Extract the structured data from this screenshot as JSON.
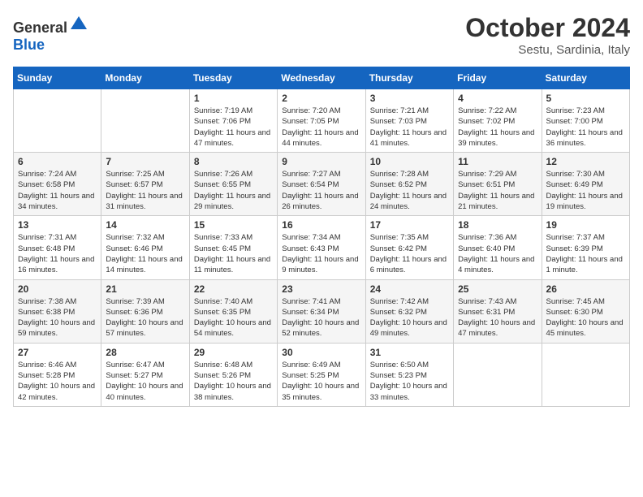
{
  "header": {
    "logo": {
      "text_general": "General",
      "text_blue": "Blue"
    },
    "title": "October 2024",
    "subtitle": "Sestu, Sardinia, Italy"
  },
  "calendar": {
    "days_of_week": [
      "Sunday",
      "Monday",
      "Tuesday",
      "Wednesday",
      "Thursday",
      "Friday",
      "Saturday"
    ],
    "weeks": [
      [
        {
          "day": "",
          "info": ""
        },
        {
          "day": "",
          "info": ""
        },
        {
          "day": "1",
          "info": "Sunrise: 7:19 AM\nSunset: 7:06 PM\nDaylight: 11 hours and 47 minutes."
        },
        {
          "day": "2",
          "info": "Sunrise: 7:20 AM\nSunset: 7:05 PM\nDaylight: 11 hours and 44 minutes."
        },
        {
          "day": "3",
          "info": "Sunrise: 7:21 AM\nSunset: 7:03 PM\nDaylight: 11 hours and 41 minutes."
        },
        {
          "day": "4",
          "info": "Sunrise: 7:22 AM\nSunset: 7:02 PM\nDaylight: 11 hours and 39 minutes."
        },
        {
          "day": "5",
          "info": "Sunrise: 7:23 AM\nSunset: 7:00 PM\nDaylight: 11 hours and 36 minutes."
        }
      ],
      [
        {
          "day": "6",
          "info": "Sunrise: 7:24 AM\nSunset: 6:58 PM\nDaylight: 11 hours and 34 minutes."
        },
        {
          "day": "7",
          "info": "Sunrise: 7:25 AM\nSunset: 6:57 PM\nDaylight: 11 hours and 31 minutes."
        },
        {
          "day": "8",
          "info": "Sunrise: 7:26 AM\nSunset: 6:55 PM\nDaylight: 11 hours and 29 minutes."
        },
        {
          "day": "9",
          "info": "Sunrise: 7:27 AM\nSunset: 6:54 PM\nDaylight: 11 hours and 26 minutes."
        },
        {
          "day": "10",
          "info": "Sunrise: 7:28 AM\nSunset: 6:52 PM\nDaylight: 11 hours and 24 minutes."
        },
        {
          "day": "11",
          "info": "Sunrise: 7:29 AM\nSunset: 6:51 PM\nDaylight: 11 hours and 21 minutes."
        },
        {
          "day": "12",
          "info": "Sunrise: 7:30 AM\nSunset: 6:49 PM\nDaylight: 11 hours and 19 minutes."
        }
      ],
      [
        {
          "day": "13",
          "info": "Sunrise: 7:31 AM\nSunset: 6:48 PM\nDaylight: 11 hours and 16 minutes."
        },
        {
          "day": "14",
          "info": "Sunrise: 7:32 AM\nSunset: 6:46 PM\nDaylight: 11 hours and 14 minutes."
        },
        {
          "day": "15",
          "info": "Sunrise: 7:33 AM\nSunset: 6:45 PM\nDaylight: 11 hours and 11 minutes."
        },
        {
          "day": "16",
          "info": "Sunrise: 7:34 AM\nSunset: 6:43 PM\nDaylight: 11 hours and 9 minutes."
        },
        {
          "day": "17",
          "info": "Sunrise: 7:35 AM\nSunset: 6:42 PM\nDaylight: 11 hours and 6 minutes."
        },
        {
          "day": "18",
          "info": "Sunrise: 7:36 AM\nSunset: 6:40 PM\nDaylight: 11 hours and 4 minutes."
        },
        {
          "day": "19",
          "info": "Sunrise: 7:37 AM\nSunset: 6:39 PM\nDaylight: 11 hours and 1 minute."
        }
      ],
      [
        {
          "day": "20",
          "info": "Sunrise: 7:38 AM\nSunset: 6:38 PM\nDaylight: 10 hours and 59 minutes."
        },
        {
          "day": "21",
          "info": "Sunrise: 7:39 AM\nSunset: 6:36 PM\nDaylight: 10 hours and 57 minutes."
        },
        {
          "day": "22",
          "info": "Sunrise: 7:40 AM\nSunset: 6:35 PM\nDaylight: 10 hours and 54 minutes."
        },
        {
          "day": "23",
          "info": "Sunrise: 7:41 AM\nSunset: 6:34 PM\nDaylight: 10 hours and 52 minutes."
        },
        {
          "day": "24",
          "info": "Sunrise: 7:42 AM\nSunset: 6:32 PM\nDaylight: 10 hours and 49 minutes."
        },
        {
          "day": "25",
          "info": "Sunrise: 7:43 AM\nSunset: 6:31 PM\nDaylight: 10 hours and 47 minutes."
        },
        {
          "day": "26",
          "info": "Sunrise: 7:45 AM\nSunset: 6:30 PM\nDaylight: 10 hours and 45 minutes."
        }
      ],
      [
        {
          "day": "27",
          "info": "Sunrise: 6:46 AM\nSunset: 5:28 PM\nDaylight: 10 hours and 42 minutes."
        },
        {
          "day": "28",
          "info": "Sunrise: 6:47 AM\nSunset: 5:27 PM\nDaylight: 10 hours and 40 minutes."
        },
        {
          "day": "29",
          "info": "Sunrise: 6:48 AM\nSunset: 5:26 PM\nDaylight: 10 hours and 38 minutes."
        },
        {
          "day": "30",
          "info": "Sunrise: 6:49 AM\nSunset: 5:25 PM\nDaylight: 10 hours and 35 minutes."
        },
        {
          "day": "31",
          "info": "Sunrise: 6:50 AM\nSunset: 5:23 PM\nDaylight: 10 hours and 33 minutes."
        },
        {
          "day": "",
          "info": ""
        },
        {
          "day": "",
          "info": ""
        }
      ]
    ]
  }
}
